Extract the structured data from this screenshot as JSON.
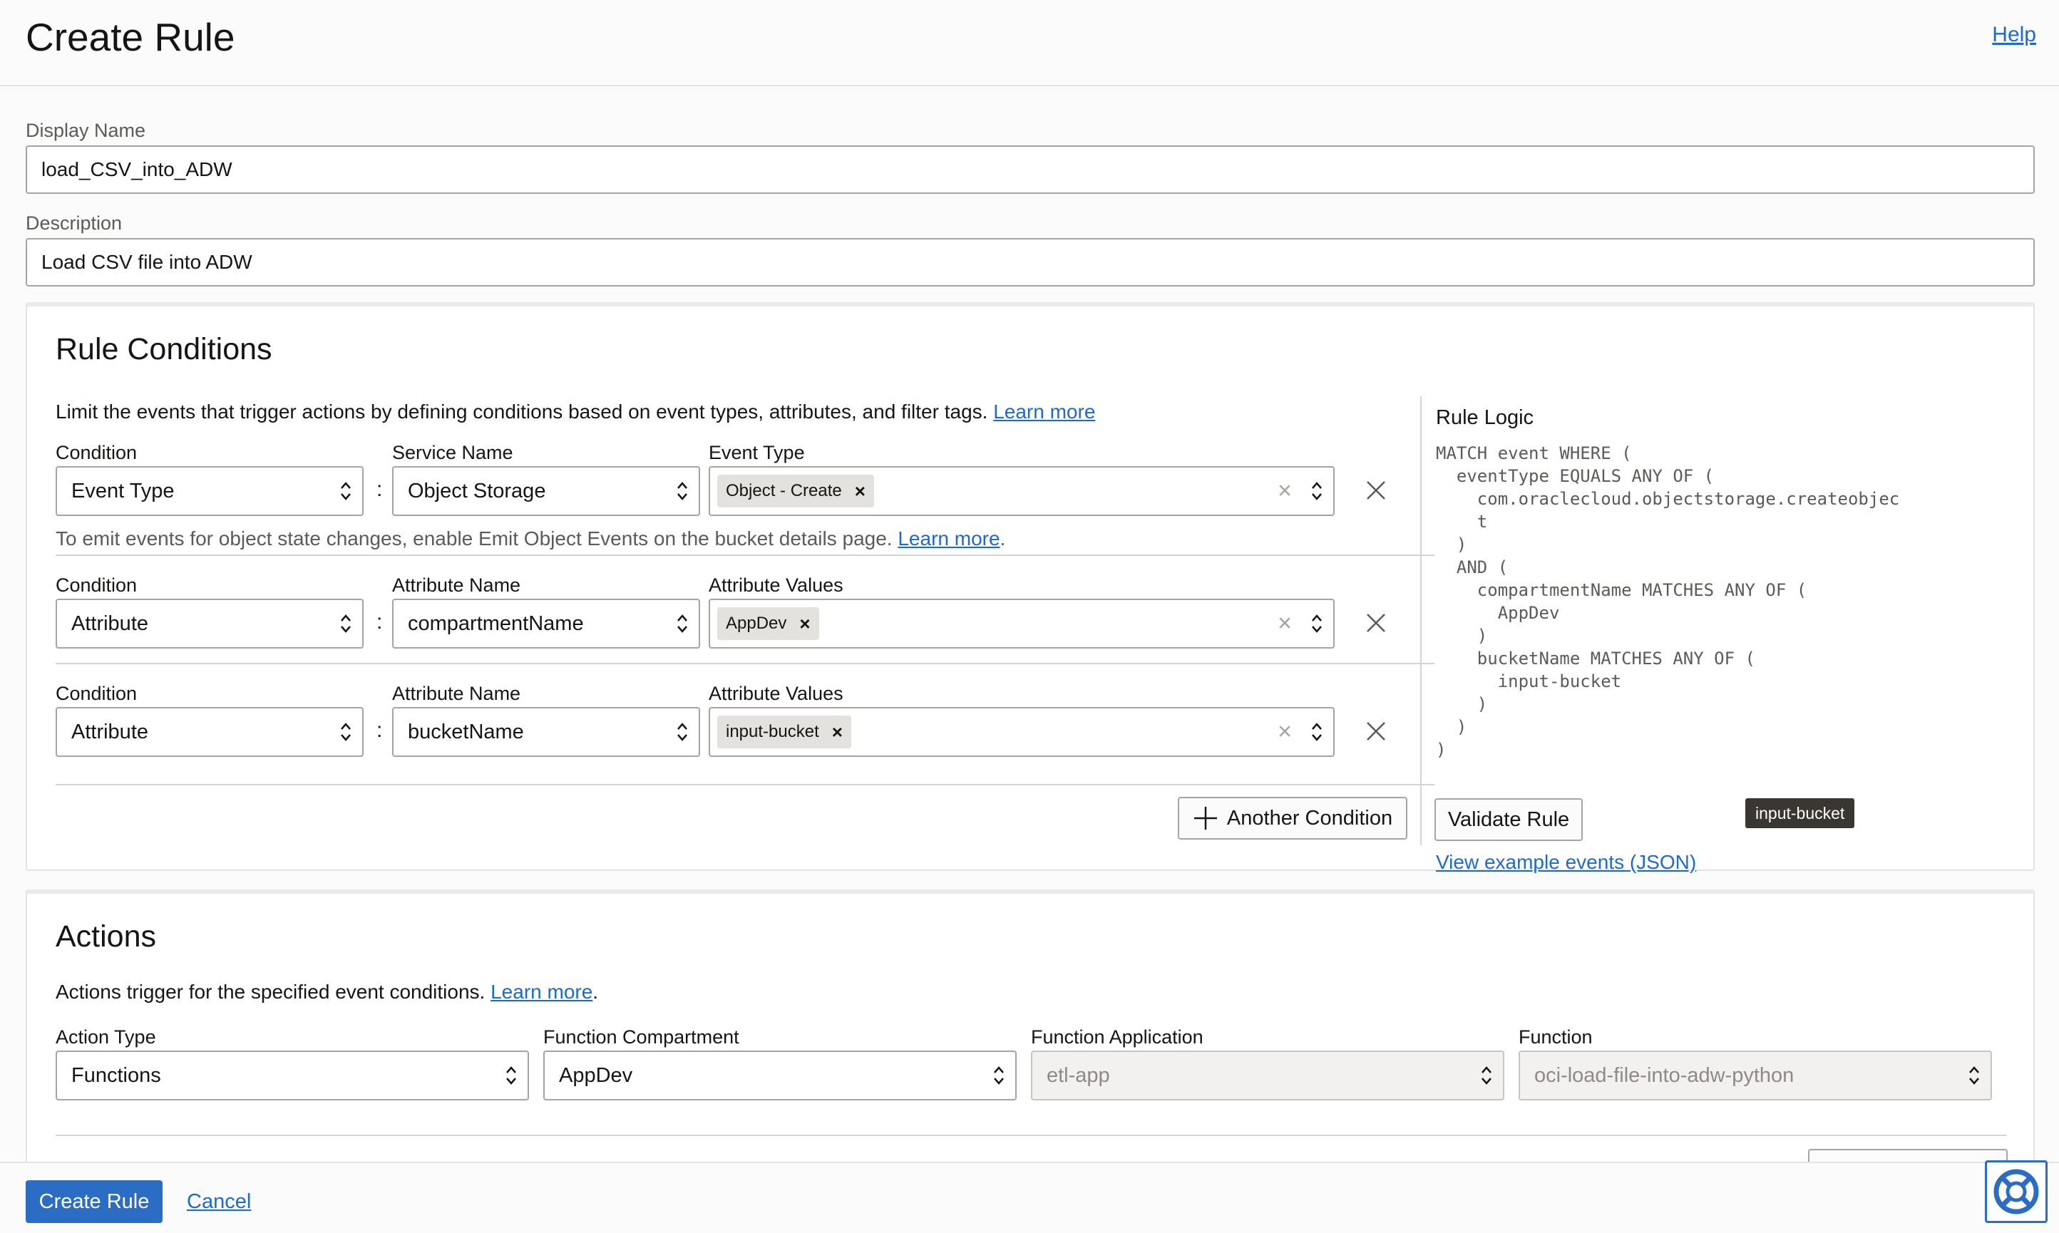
{
  "header": {
    "title": "Create Rule",
    "help": "Help"
  },
  "display_name": {
    "label": "Display Name",
    "value": "load_CSV_into_ADW"
  },
  "description": {
    "label": "Description",
    "value": "Load CSV file into ADW"
  },
  "rule_conditions": {
    "title": "Rule Conditions",
    "intro": "Limit the events that trigger actions by defining conditions based on event types, attributes, and filter tags.",
    "learn_more": "Learn more",
    "conditions": [
      {
        "condition_label": "Condition",
        "condition_value": "Event Type",
        "name_label": "Service Name",
        "name_value": "Object Storage",
        "values_label": "Event Type",
        "chip": "Object - Create"
      },
      {
        "condition_label": "Condition",
        "condition_value": "Attribute",
        "name_label": "Attribute Name",
        "name_value": "compartmentName",
        "values_label": "Attribute Values",
        "chip": "AppDev"
      },
      {
        "condition_label": "Condition",
        "condition_value": "Attribute",
        "name_label": "Attribute Name",
        "name_value": "bucketName",
        "values_label": "Attribute Values",
        "chip": "input-bucket"
      }
    ],
    "hint": "To emit events for object state changes, enable Emit Object Events on the bucket details page.",
    "hint_link": "Learn more",
    "another_condition": "Another Condition",
    "rule_logic": {
      "title": "Rule Logic",
      "code": "MATCH event WHERE (\n  eventType EQUALS ANY OF (\n    com.oraclecloud.objectstorage.createobjec\n    t\n  )\n  AND (\n    compartmentName MATCHES ANY OF (\n      AppDev\n    )\n    bucketName MATCHES ANY OF (\n      input-bucket\n    )\n  )\n)",
      "tooltip": "input-bucket",
      "view_examples": "View example events (JSON)",
      "validate": "Validate Rule"
    }
  },
  "actions": {
    "title": "Actions",
    "intro": "Actions trigger for the specified event conditions.",
    "learn_more": "Learn more",
    "action_type": {
      "label": "Action Type",
      "value": "Functions"
    },
    "function_compartment": {
      "label": "Function Compartment",
      "value": "AppDev"
    },
    "function_application": {
      "label": "Function Application",
      "value": "etl-app"
    },
    "function": {
      "label": "Function",
      "value": "oci-load-file-into-adw-python"
    }
  },
  "footer": {
    "create": "Create Rule",
    "cancel": "Cancel"
  }
}
